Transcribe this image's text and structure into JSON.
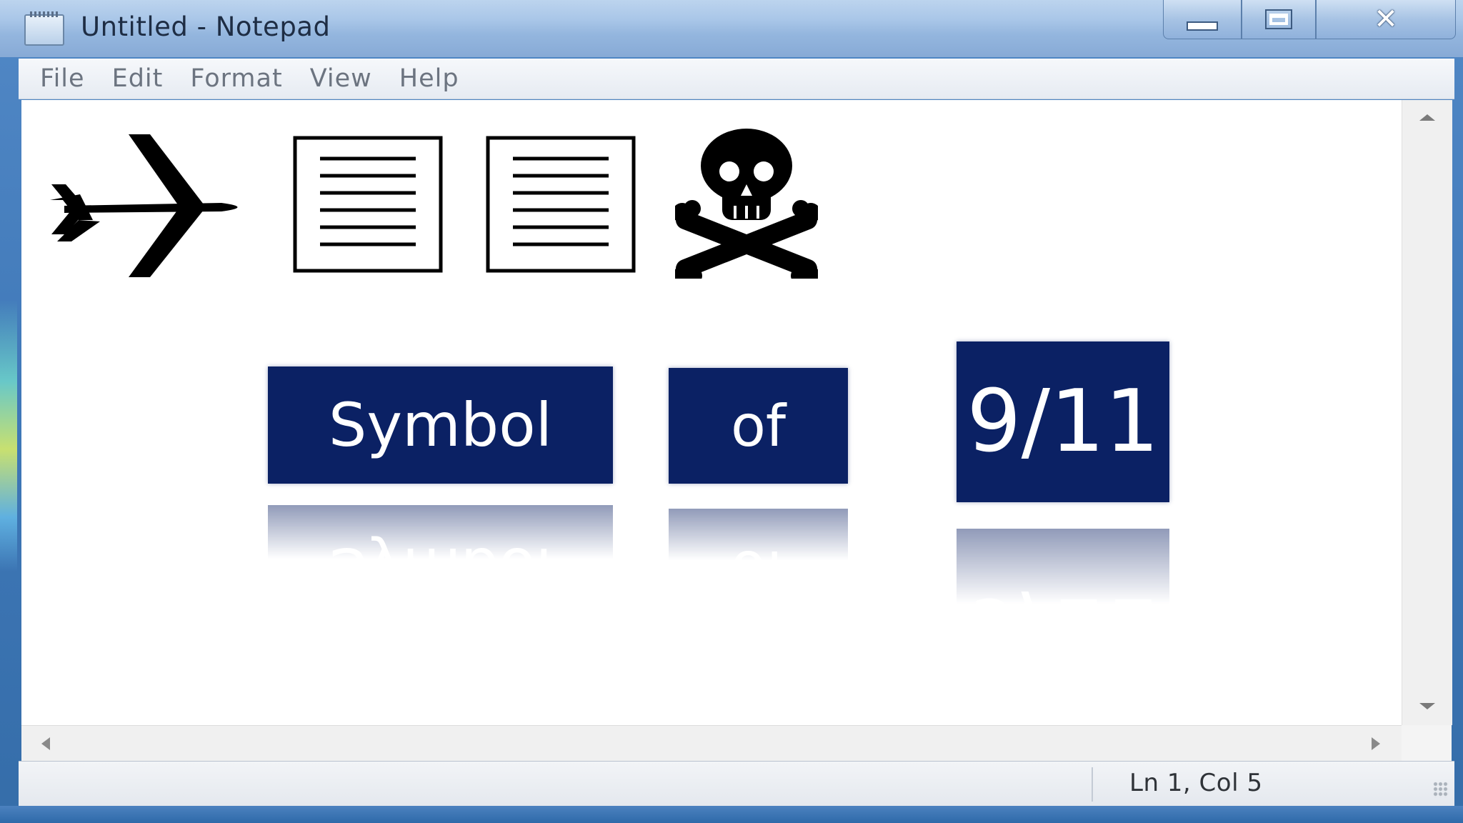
{
  "window": {
    "title": "Untitled - Notepad",
    "controls": {
      "minimize": "minimize",
      "maximize": "maximize",
      "close": "✕"
    }
  },
  "menu": {
    "items": [
      {
        "label": "File"
      },
      {
        "label": "Edit"
      },
      {
        "label": "Format"
      },
      {
        "label": "View"
      },
      {
        "label": "Help"
      }
    ]
  },
  "content": {
    "symbols": [
      "airplane-icon",
      "document-icon",
      "document-icon",
      "skull-crossbones-icon"
    ],
    "words": [
      {
        "text": "Symbol"
      },
      {
        "text": "of"
      },
      {
        "text": "9/11"
      }
    ],
    "word_color": "#0b2164"
  },
  "status": {
    "position": "Ln 1, Col 5"
  }
}
